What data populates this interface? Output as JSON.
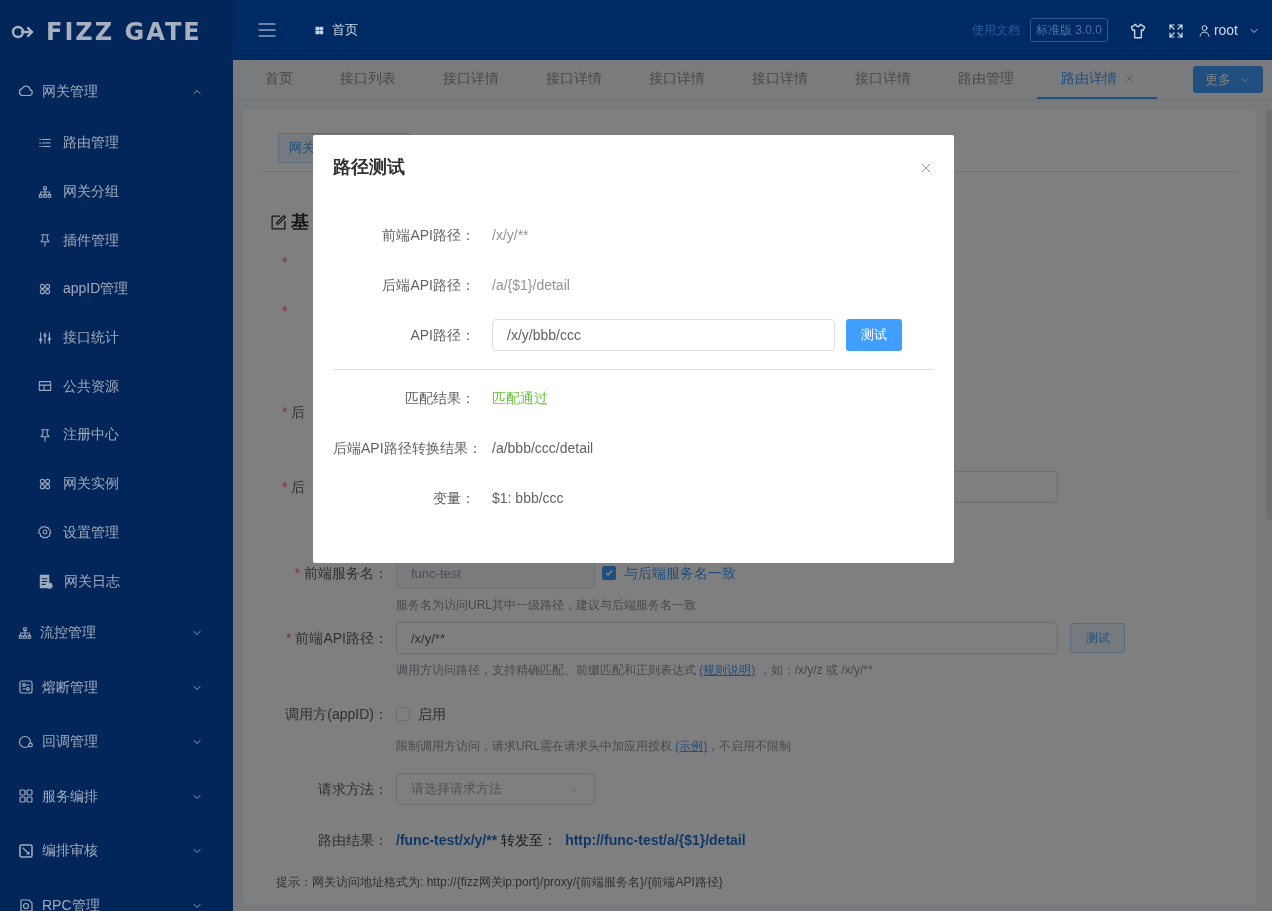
{
  "sidebar": {
    "logo": "FIZZ GATE",
    "groups": [
      {
        "label": "网关管理",
        "expanded": true,
        "children": [
          {
            "label": "路由管理"
          },
          {
            "label": "网关分组"
          },
          {
            "label": "插件管理"
          },
          {
            "label": "appID管理"
          },
          {
            "label": "接口统计"
          },
          {
            "label": "公共资源"
          },
          {
            "label": "注册中心"
          },
          {
            "label": "网关实例"
          },
          {
            "label": "设置管理"
          },
          {
            "label": "网关日志"
          }
        ]
      },
      {
        "label": "流控管理",
        "expanded": false
      },
      {
        "label": "熔断管理",
        "expanded": false
      },
      {
        "label": "回调管理",
        "expanded": false
      },
      {
        "label": "服务编排",
        "expanded": false
      },
      {
        "label": "编排审核",
        "expanded": false
      },
      {
        "label": "RPC管理",
        "expanded": false
      }
    ]
  },
  "header": {
    "breadcrumb": "首页",
    "docs_link": "使用文档",
    "version": "标准版 3.0.0",
    "user": "root"
  },
  "tabs": [
    {
      "label": "首页",
      "selected": false,
      "closable": false
    },
    {
      "label": "接口列表",
      "selected": false,
      "closable": false
    },
    {
      "label": "接口详情",
      "selected": false,
      "closable": false
    },
    {
      "label": "接口详情",
      "selected": false,
      "closable": false
    },
    {
      "label": "接口详情",
      "selected": false,
      "closable": false
    },
    {
      "label": "接口详情",
      "selected": false,
      "closable": false
    },
    {
      "label": "接口详情",
      "selected": false,
      "closable": false
    },
    {
      "label": "路由管理",
      "selected": false,
      "closable": false
    },
    {
      "label": "路由详情",
      "selected": true,
      "closable": true
    }
  ],
  "more_button": "更多",
  "form": {
    "top_button": "网关",
    "heading": "基",
    "items": [
      {
        "kind": "mark_only",
        "mark": "*"
      },
      {
        "kind": "mark_only",
        "mark": "*"
      },
      {
        "kind": "partial",
        "mark": "*",
        "label": "后"
      },
      {
        "kind": "partial_input",
        "mark": "*",
        "label": "后"
      },
      {
        "kind": "service",
        "mark": "*",
        "label": "前端服务名：",
        "value": "func-test",
        "disabled": true,
        "checkbox": {
          "label": "与后端服务名一致",
          "checked": true
        },
        "help": [
          {
            "text": "服务名为访问URL其中一级路径，建议与后端服务名一致",
            "link": false
          }
        ]
      },
      {
        "kind": "input_button",
        "mark": "*",
        "label": "前端API路径：",
        "value": "/x/y/**",
        "button": "测试",
        "help": [
          {
            "text": "调用方访问路径，支持精确匹配、前缀匹配和正则表达式 ",
            "link": false
          },
          {
            "text": "(规则说明)",
            "link": true
          },
          {
            "text": " ，如：/x/y/z 或 /x/y/**",
            "link": false
          }
        ]
      },
      {
        "kind": "checkbox",
        "label": "调用方(appID)：",
        "checkbox": {
          "label": "启用",
          "checked": false
        },
        "help": [
          {
            "text": "限制调用方访问，请求URL需在请求头中加应用授权 ",
            "link": false
          },
          {
            "text": "(示例)",
            "link": true
          },
          {
            "text": "，不启用不限制",
            "link": false
          }
        ]
      },
      {
        "kind": "select",
        "label": "请求方法：",
        "placeholder": "请选择请求方法"
      },
      {
        "kind": "result",
        "label": "路由结果：",
        "path": "/func-test/x/y/**",
        "forward_label": "转发至：",
        "target": "http://func-test/a/{$1}/detail"
      }
    ],
    "tip": "提示：网关访问地址格式为: http://{fizz网关ip:port}/proxy/{前端服务名}/{前端API路径}"
  },
  "modal": {
    "title": "路径测试",
    "rows": [
      {
        "kind": "text",
        "label": "前端API路径：",
        "value": "/x/y/**",
        "muted": true
      },
      {
        "kind": "text",
        "label": "后端API路径：",
        "value": "/a/{$1}/detail",
        "muted": true
      },
      {
        "kind": "input",
        "label": "API路径：",
        "value": "/x/y/bbb/ccc",
        "button": "测试"
      },
      {
        "kind": "divider"
      },
      {
        "kind": "status",
        "label": "匹配结果：",
        "value": "匹配通过",
        "passed": true
      },
      {
        "kind": "text",
        "label": "后端API路径转换结果：",
        "value": "/a/bbb/ccc/detail",
        "muted": false
      },
      {
        "kind": "text",
        "label": "变量：",
        "value": "$1: bbb/ccc",
        "muted": false
      }
    ]
  }
}
